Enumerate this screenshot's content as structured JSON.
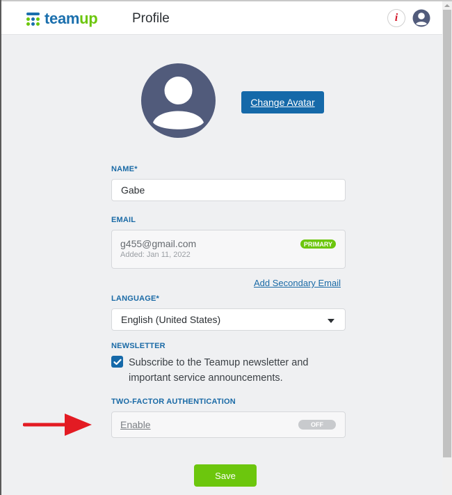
{
  "header": {
    "logo_text_part1": "team",
    "logo_text_part2": "up",
    "title": "Profile",
    "info_icon_glyph": "i",
    "icons": [
      "teamup-logo-icon",
      "info-icon",
      "user-account-icon"
    ]
  },
  "avatar": {
    "icon": "user-avatar-icon",
    "change_label": "Change Avatar"
  },
  "form": {
    "name": {
      "label": "NAME*",
      "value": "Gabe"
    },
    "email": {
      "label": "EMAIL",
      "address": "g455@gmail.com",
      "added": "Added: Jan 11, 2022",
      "badge": "PRIMARY",
      "add_secondary_label": "Add Secondary Email"
    },
    "language": {
      "label": "LANGUAGE*",
      "selected": "English (United States)"
    },
    "newsletter": {
      "label": "NEWSLETTER",
      "checked": true,
      "text": "Subscribe to the Teamup newsletter and important service announcements."
    },
    "two_factor": {
      "label": "TWO-FACTOR AUTHENTICATION",
      "enable_label": "Enable",
      "toggle_state": "OFF"
    },
    "save_label": "Save"
  },
  "annotation": {
    "type": "red-arrow",
    "points_to": "two-factor-enable"
  },
  "colors": {
    "brand_blue": "#1569a9",
    "brand_green": "#6cc60d",
    "label_blue": "#1a6aa6",
    "arrow_red": "#e31b23",
    "background": "#eff0f2"
  }
}
